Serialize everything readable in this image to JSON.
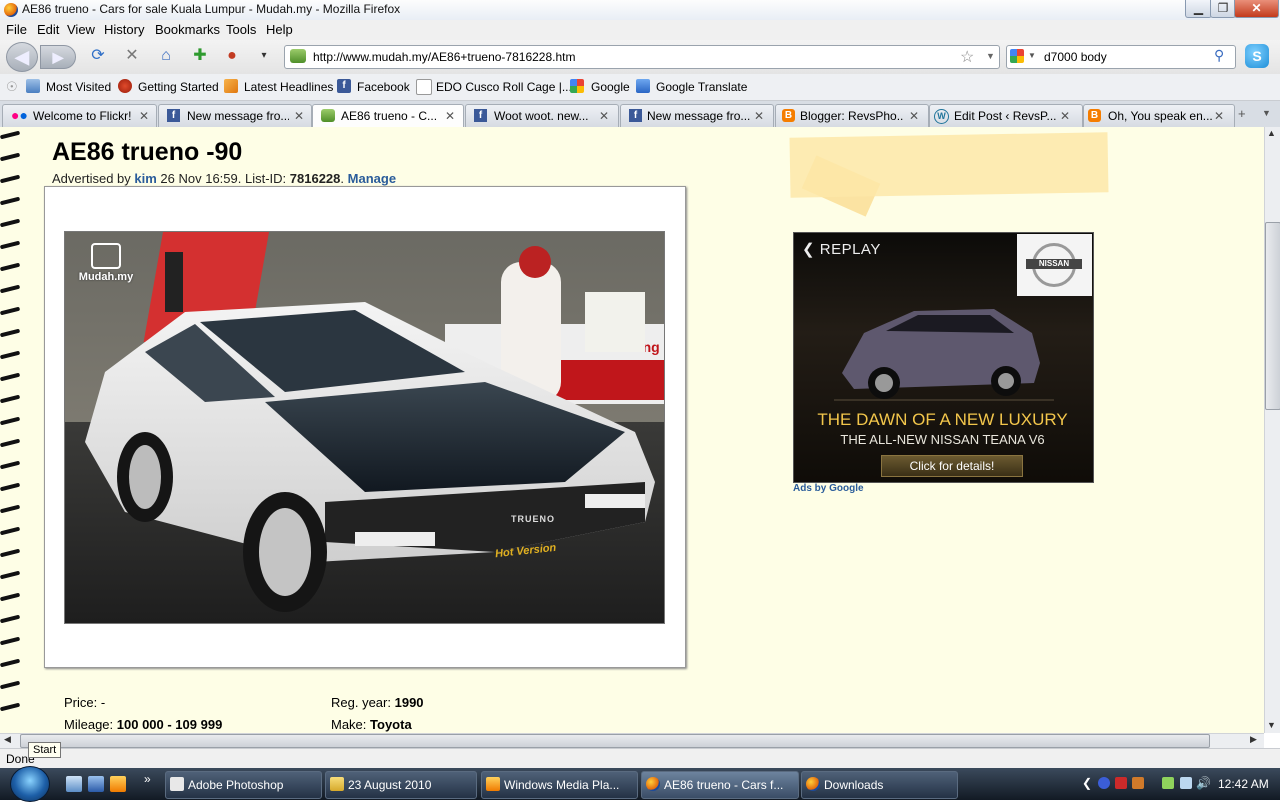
{
  "window": {
    "title": "AE86 trueno - Cars for sale Kuala Lumpur - Mudah.my - Mozilla Firefox",
    "minimize": "▁",
    "maximize": "❐",
    "close": "✕"
  },
  "menu": [
    "File",
    "Edit",
    "View",
    "History",
    "Bookmarks",
    "Tools",
    "Help"
  ],
  "nav": {
    "url": "http://www.mudah.my/AE86+trueno-7816228.htm",
    "search_value": "d7000 body"
  },
  "bookmarks": [
    "Most Visited",
    "Getting Started",
    "Latest Headlines",
    "Facebook",
    "EDO Cusco Roll Cage |...",
    "Google",
    "Google Translate"
  ],
  "tabs": [
    "Welcome to Flickr!",
    "New message fro...",
    "AE86 trueno - C...",
    "Woot woot. new...",
    "New message fro...",
    "Blogger: RevsPho...",
    "Edit Post ‹ RevsP...",
    "Oh, You speak en..."
  ],
  "page": {
    "title": "AE86 trueno -90",
    "advertised_by": "Advertised by",
    "user": "kim",
    "date": "26 Nov 16:59. List-ID:",
    "list_id": "7816228",
    "sep": ".",
    "manage": "Manage",
    "watermark": "Mudah.my",
    "car_badge": "TRUENO",
    "car_sticker": "Hot Version",
    "price_label": "Price:",
    "price_value": "-",
    "mileage_label": "Mileage:",
    "mileage_value": "100 000 - 109 999",
    "regyear_label": "Reg. year:",
    "regyear_value": "1990",
    "make_label": "Make:",
    "make_value": "Toyota"
  },
  "ad": {
    "replay": "REPLAY",
    "brand": "NISSAN",
    "headline": "THE DAWN OF A NEW LUXURY",
    "subline": "THE ALL-NEW NISSAN TEANA V6",
    "cta": "Click for details!",
    "ads_by": "Ads by Google"
  },
  "status": {
    "text": "Done",
    "tooltip": "Start"
  },
  "taskbar": {
    "tasks": [
      "Adobe Photoshop",
      "23 August 2010",
      "Windows Media Pla...",
      "AE86 trueno - Cars f...",
      "Downloads"
    ],
    "clock": "12:42 AM"
  }
}
